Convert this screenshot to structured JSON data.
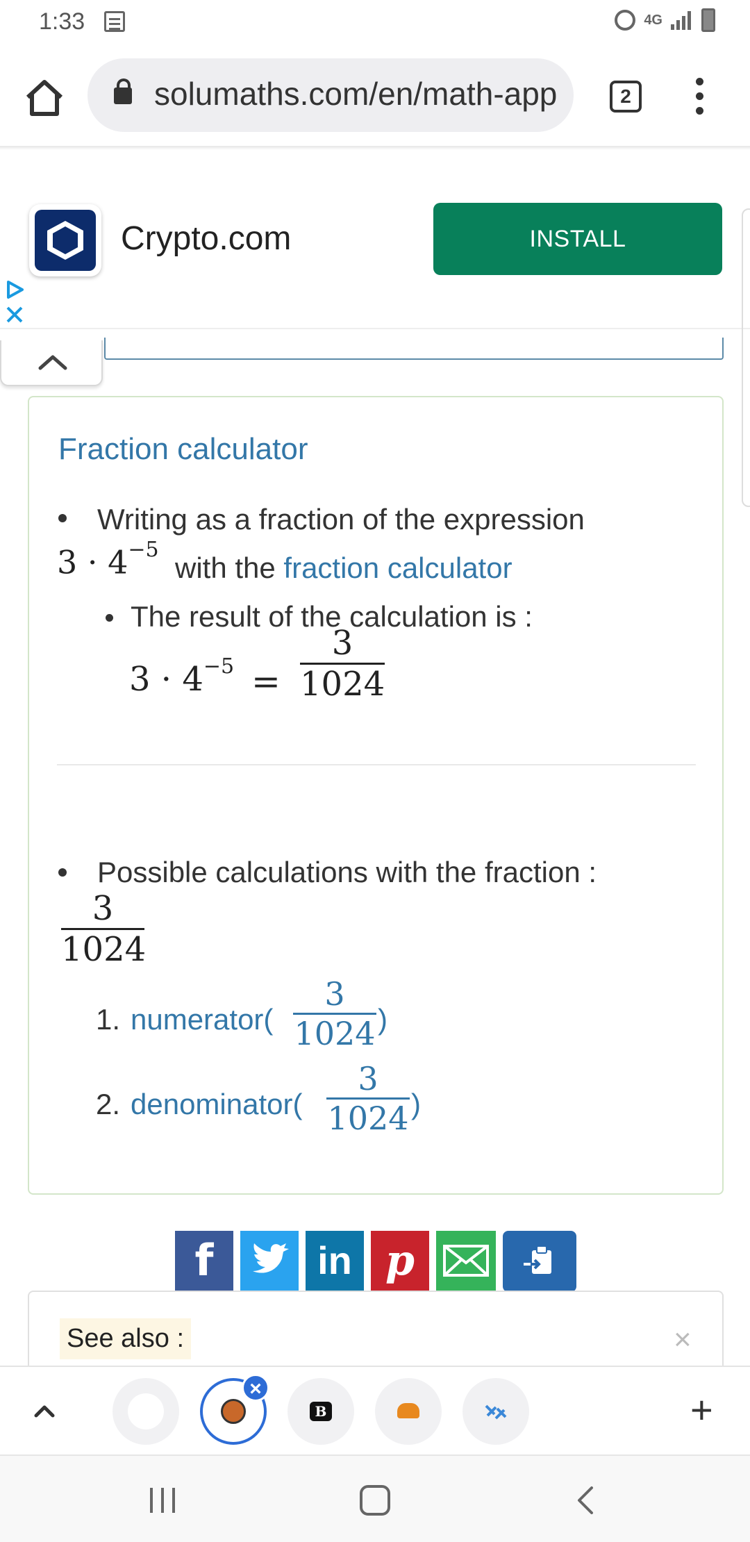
{
  "status_bar": {
    "time": "1:33",
    "network": "4G"
  },
  "browser": {
    "url": "solumaths.com/en/math-app",
    "tab_count": "2"
  },
  "ad": {
    "title": "Crypto.com",
    "install_label": "INSTALL"
  },
  "card": {
    "title": "Fraction calculator",
    "section1": {
      "intro": "Writing as a fraction of the expression",
      "expr_base": "3 · 4",
      "expr_exp": "−5",
      "with_the": "with the",
      "link": "fraction calculator",
      "result_intro": "The result of the calculation is :",
      "result_lhs_base": "3 · 4",
      "result_lhs_exp": "−5",
      "equals": "=",
      "numerator": "3",
      "denominator": "1024"
    },
    "section2": {
      "intro": "Possible calculations with the fraction :",
      "numerator": "3",
      "denominator": "1024",
      "items": [
        {
          "number": "1.",
          "label": "numerator(",
          "close": ")",
          "numerator": "3",
          "denominator": "1024"
        },
        {
          "number": "2.",
          "label": "denominator(",
          "close": ")",
          "numerator": "3",
          "denominator": "1024"
        }
      ]
    }
  },
  "share": {
    "facebook": "f",
    "twitter": "twitter-bird-icon",
    "linkedin": "in",
    "pinterest": "p",
    "email": "envelope-icon",
    "copy": "clipboard-icon"
  },
  "see_also": {
    "label": "See also :",
    "close": "×"
  },
  "tab_strip": {
    "close": "×",
    "add": "+",
    "accent": "#2d6cd6"
  },
  "colors": {
    "link": "#3377a8",
    "install": "#08805a",
    "card_border": "#d3e6c9"
  }
}
